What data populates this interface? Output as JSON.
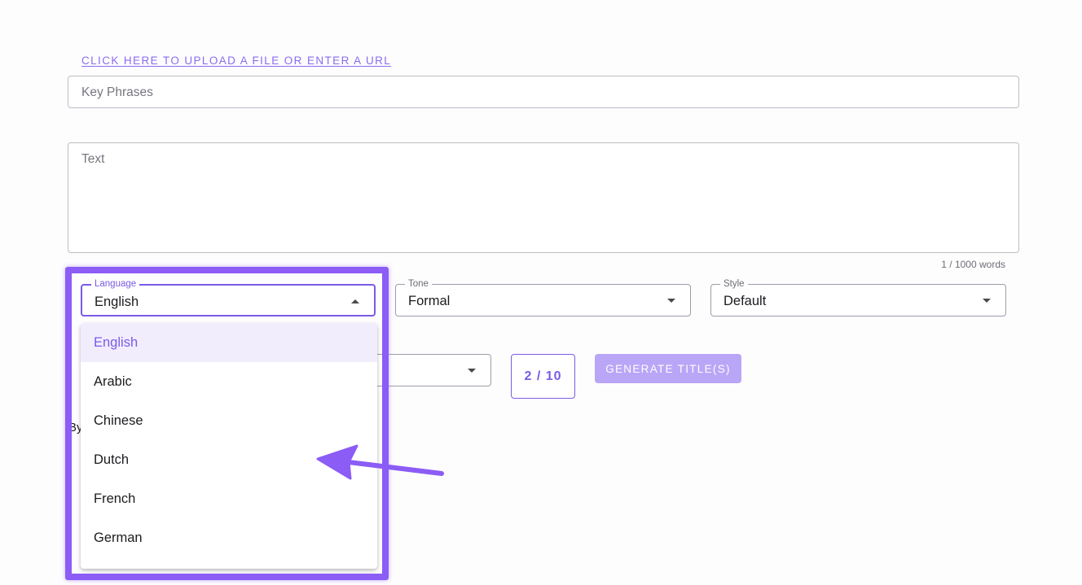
{
  "upload_link": "CLICK HERE TO UPLOAD A FILE OR ENTER A URL",
  "key_phrases": {
    "placeholder": "Key Phrases",
    "value": ""
  },
  "text": {
    "placeholder": "Text",
    "value": ""
  },
  "word_count": "1 / 1000 words",
  "language": {
    "label": "Language",
    "value": "English"
  },
  "tone": {
    "label": "Tone",
    "value": "Formal"
  },
  "style": {
    "label": "Style",
    "value": "Default"
  },
  "counter": "2 / 10",
  "generate_button": "GENERATE TITLE(S)",
  "background_fragment": "By",
  "language_options": [
    "English",
    "Arabic",
    "Chinese",
    "Dutch",
    "French",
    "German"
  ],
  "selected_option": "English",
  "colors": {
    "accent": "#7b5be6",
    "annotation": "#8b5cf6",
    "button_disabled": "#b9a6f7"
  }
}
